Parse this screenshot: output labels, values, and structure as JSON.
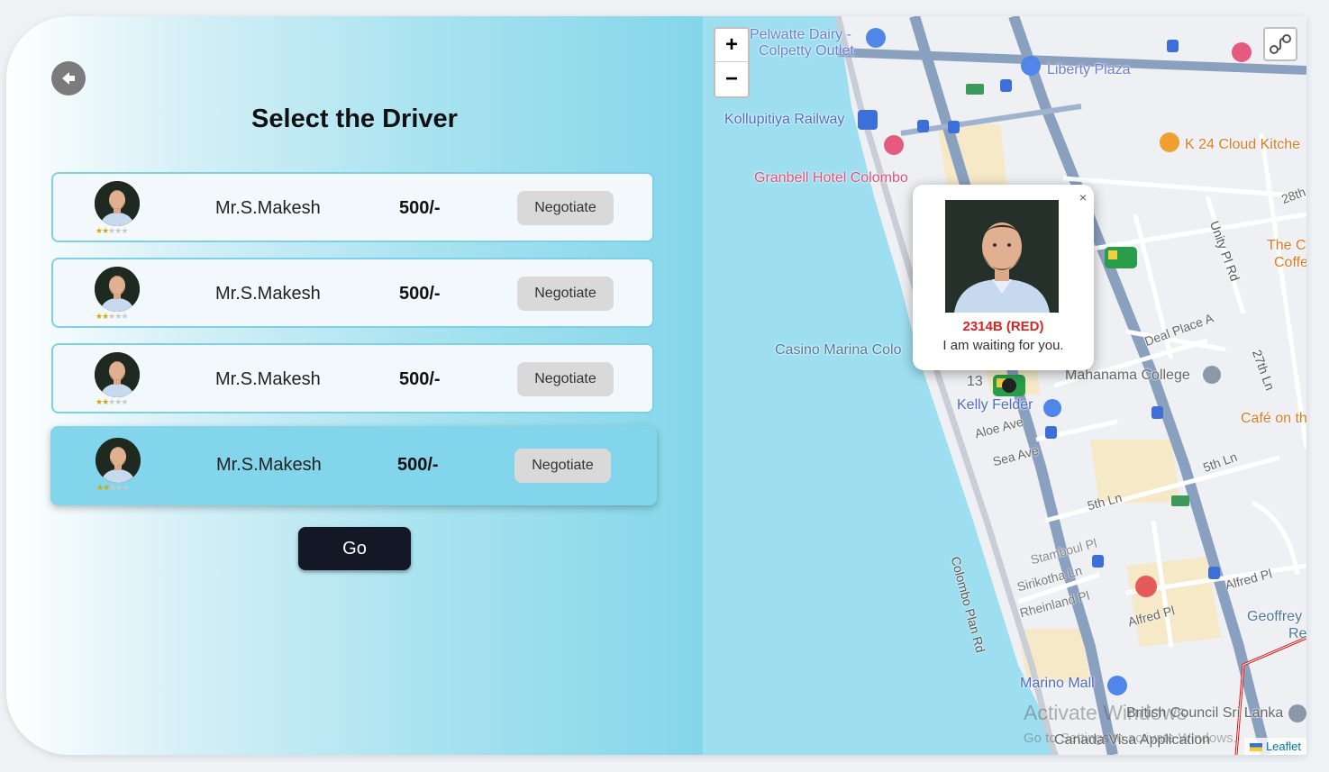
{
  "page": {
    "title": "Select the Driver",
    "go_label": "Go"
  },
  "drivers": [
    {
      "name": "Mr.S.Makesh",
      "price": "500/-",
      "negotiate_label": "Negotiate",
      "rating": 2,
      "max_rating": 5
    },
    {
      "name": "Mr.S.Makesh",
      "price": "500/-",
      "negotiate_label": "Negotiate",
      "rating": 2,
      "max_rating": 5
    },
    {
      "name": "Mr.S.Makesh",
      "price": "500/-",
      "negotiate_label": "Negotiate",
      "rating": 2,
      "max_rating": 5
    },
    {
      "name": "Mr.S.Makesh",
      "price": "500/-",
      "negotiate_label": "Negotiate",
      "rating": 2,
      "max_rating": 5,
      "selected": true
    }
  ],
  "map": {
    "zoom_in_label": "+",
    "zoom_out_label": "−",
    "attribution": "Leaflet",
    "labels": [
      {
        "text": "Pelwatte Dairy -",
        "color": "#6a7fd0"
      },
      {
        "text": "Colpetty Outlet",
        "color": "#6a7fd0"
      },
      {
        "text": "Liberty Plaza",
        "color": "#6a7fd0"
      },
      {
        "text": "Kollupitiya Railway",
        "color": "#4f6bc8"
      },
      {
        "text": "Granbell Hotel Colombo",
        "color": "#e0507a"
      },
      {
        "text": "K 24 Cloud Kitche",
        "color": "#e07a20"
      },
      {
        "text": "28th",
        "color": "#666"
      },
      {
        "text": "Unity Pl Rd",
        "color": "#555"
      },
      {
        "text": "The C",
        "color": "#e07a20"
      },
      {
        "text": "Coffe",
        "color": "#e07a20"
      },
      {
        "text": "Casino Marina Colo",
        "color": "#4f7a98"
      },
      {
        "text": "Deal Place A",
        "color": "#666"
      },
      {
        "text": "Mahanama College",
        "color": "#666"
      },
      {
        "text": "27th Ln",
        "color": "#555"
      },
      {
        "text": "Kelly Felder",
        "color": "#4f6bc8"
      },
      {
        "text": "Café on th",
        "color": "#e07a20"
      },
      {
        "text": "Aloe Ave",
        "color": "#666"
      },
      {
        "text": "Sea Ave",
        "color": "#666"
      },
      {
        "text": "5th Ln",
        "color": "#666"
      },
      {
        "text": "5th Ln",
        "color": "#666"
      },
      {
        "text": "Colombo Plan Rd",
        "color": "#555"
      },
      {
        "text": "Stamboul Pl",
        "color": "#888"
      },
      {
        "text": "Sirikotha Ln",
        "color": "#777"
      },
      {
        "text": "Rheinland Pl",
        "color": "#777"
      },
      {
        "text": "Alfred Pl",
        "color": "#666"
      },
      {
        "text": "Alfred Pl",
        "color": "#666"
      },
      {
        "text": "Geoffrey",
        "color": "#4f7a98"
      },
      {
        "text": "Re",
        "color": "#4f7a98"
      },
      {
        "text": "Marino Mall",
        "color": "#4f6bc8"
      },
      {
        "text": "British Council Sri Lanka",
        "color": "#666"
      },
      {
        "text": "Canada Visa Application",
        "color": "#666"
      },
      {
        "text": "13",
        "color": "#666"
      }
    ],
    "popup": {
      "plate": "2314B (RED)",
      "message": "I am waiting for you.",
      "close_label": "×"
    },
    "watermark_line1": "Activate Windows",
    "watermark_line2": "Go to Settings to activate Windows."
  }
}
